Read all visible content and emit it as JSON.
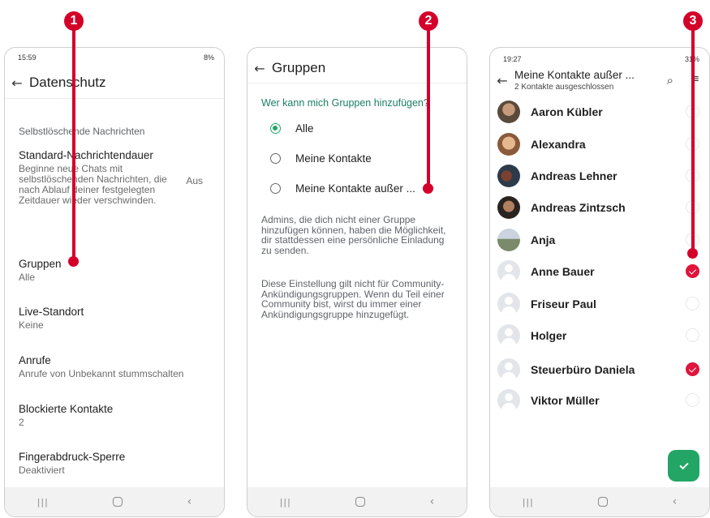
{
  "callouts": [
    "1",
    "2",
    "3"
  ],
  "phone1": {
    "status": {
      "time": "15:59",
      "right": "8%"
    },
    "title": "Datenschutz",
    "section": "Selbstlöschende Nachrichten",
    "timer": {
      "title": "Standard-Nachrichtendauer",
      "desc": "Beginne neue Chats mit selbstlöschenden Nachrichten, die nach Ablauf deiner festgelegten Zeitdauer wieder verschwinden.",
      "value": "Aus"
    },
    "settings": [
      {
        "title": "Gruppen",
        "value": "Alle"
      },
      {
        "title": "Live-Standort",
        "value": "Keine"
      },
      {
        "title": "Anrufe",
        "value": "Anrufe von Unbekannt stummschalten"
      },
      {
        "title": "Blockierte Kontakte",
        "value": "2"
      },
      {
        "title": "Fingerabdruck-Sperre",
        "value": "Deaktiviert"
      }
    ]
  },
  "phone2": {
    "title": "Gruppen",
    "question": "Wer kann mich Gruppen hinzufügen?",
    "options": [
      "Alle",
      "Meine Kontakte",
      "Meine Kontakte außer ..."
    ],
    "selected": "Alle",
    "info1": "Admins, die dich nicht einer Gruppe hinzufügen können, haben die Möglichkeit, dir stattdessen eine persönliche Einladung zu senden.",
    "info2": "Diese Einstellung gilt nicht für Community-Ankündigungsgruppen. Wenn du Teil einer Community bist, wirst du immer einer Ankündigungsgruppe hinzugefügt."
  },
  "phone3": {
    "status": {
      "time": "19:27",
      "right": "31%"
    },
    "title": "Meine Kontakte außer ...",
    "subtitle": "2 Kontakte ausgeschlossen",
    "contacts": [
      {
        "name": "Aaron Kübler",
        "checked": false,
        "avatar": "photo"
      },
      {
        "name": "Alexandra",
        "checked": false,
        "avatar": "photo"
      },
      {
        "name": "Andreas Lehner",
        "checked": false,
        "avatar": "photo"
      },
      {
        "name": "Andreas Zintzsch",
        "checked": false,
        "avatar": "photo"
      },
      {
        "name": "Anja",
        "checked": false,
        "avatar": "photo"
      },
      {
        "name": "Anne Bauer",
        "checked": true,
        "avatar": "blank"
      },
      {
        "name": "Friseur Paul",
        "checked": false,
        "avatar": "blank"
      },
      {
        "name": "Holger",
        "checked": false,
        "avatar": "blank"
      },
      {
        "name": "Steuerbüro Daniela",
        "checked": true,
        "avatar": "blank"
      },
      {
        "name": "Viktor Müller",
        "checked": false,
        "avatar": "blank"
      }
    ]
  },
  "icons": {
    "back": "arrow-left-icon",
    "search": "search-icon",
    "select_all": "select-all-icon",
    "confirm": "check-icon",
    "nav_recent": "recent-apps-icon",
    "nav_home": "home-icon",
    "nav_back": "nav-back-icon"
  },
  "colors": {
    "callout": "#d4002a",
    "accent_green": "#22a565",
    "checked_red": "#e0143c"
  }
}
